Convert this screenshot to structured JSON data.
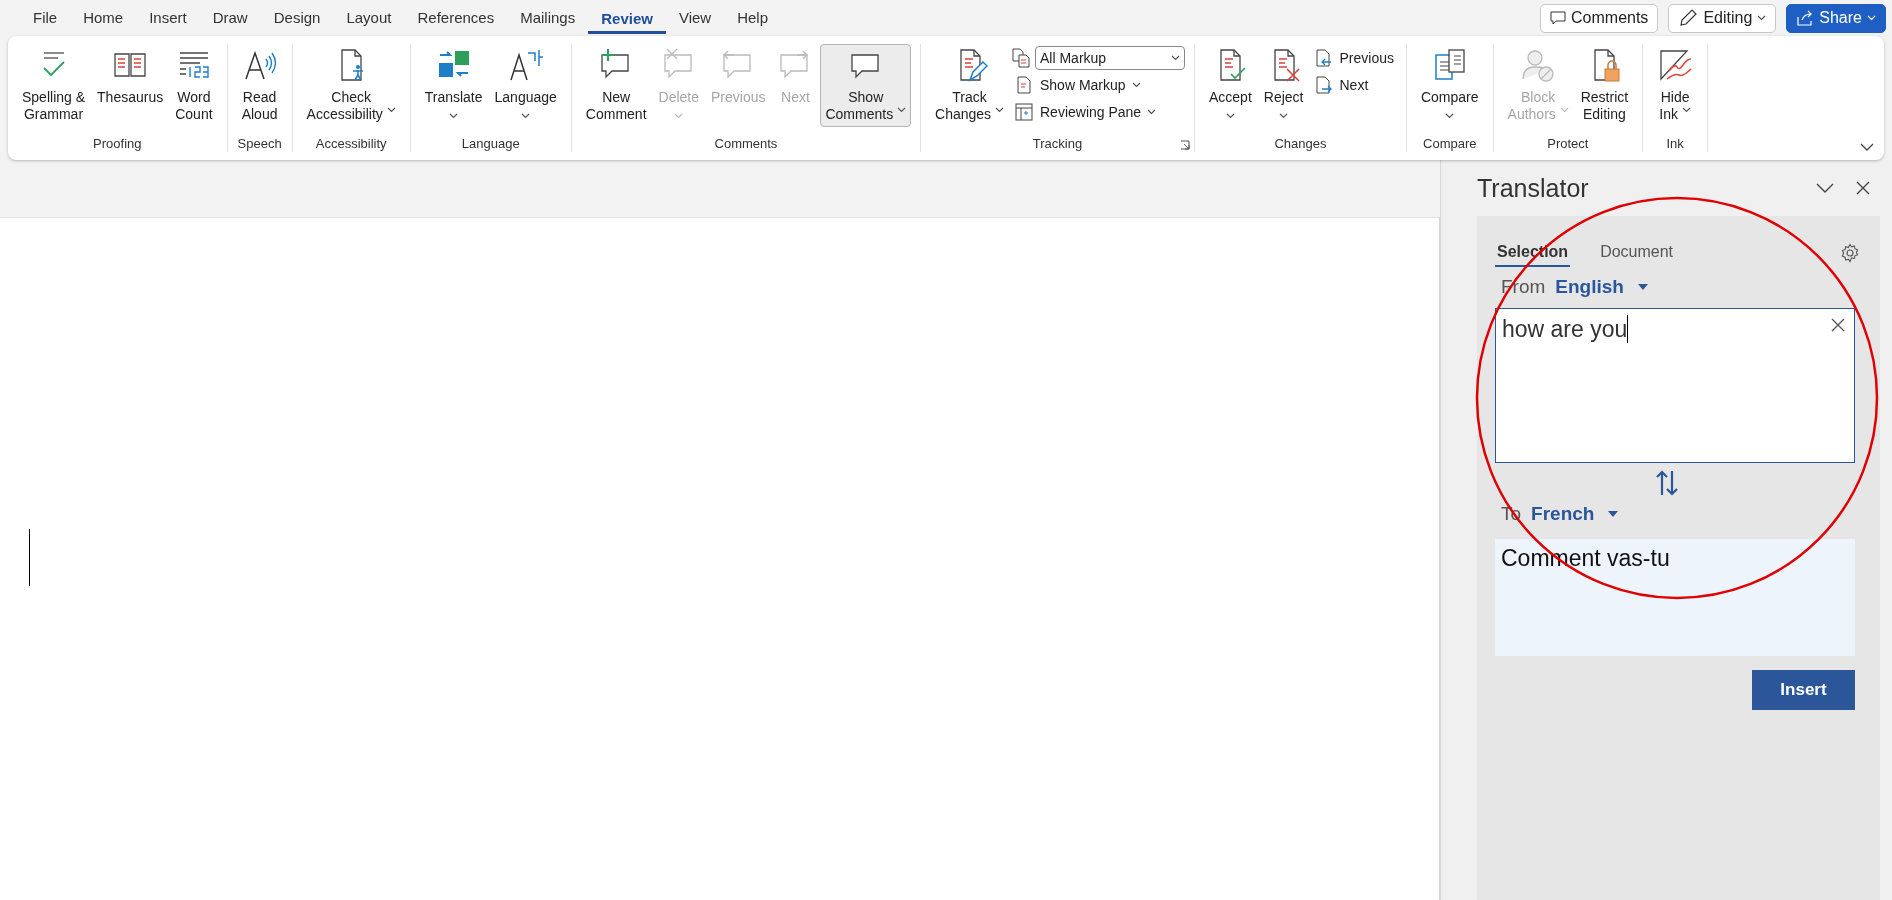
{
  "menu_tabs": [
    {
      "label": "File",
      "selected": false
    },
    {
      "label": "Home",
      "selected": false
    },
    {
      "label": "Insert",
      "selected": false
    },
    {
      "label": "Draw",
      "selected": false
    },
    {
      "label": "Design",
      "selected": false
    },
    {
      "label": "Layout",
      "selected": false
    },
    {
      "label": "References",
      "selected": false
    },
    {
      "label": "Mailings",
      "selected": false
    },
    {
      "label": "Review",
      "selected": true
    },
    {
      "label": "View",
      "selected": false
    },
    {
      "label": "Help",
      "selected": false
    }
  ],
  "header_buttons": [
    {
      "kind": "comments",
      "label": "Comments"
    },
    {
      "kind": "mode",
      "label": "Editing"
    },
    {
      "kind": "share",
      "label": "Share"
    }
  ],
  "ribbon": {
    "groups": [
      {
        "label": "Proofing",
        "items": [
          {
            "kind": "large",
            "label": "Spelling &\nGrammar",
            "disabled": false,
            "pressed": false,
            "caret": false
          },
          {
            "kind": "large",
            "label": "Thesaurus",
            "disabled": false,
            "pressed": false,
            "caret": false
          },
          {
            "kind": "large",
            "label": "Word\nCount",
            "disabled": false,
            "pressed": false,
            "caret": false
          }
        ]
      },
      {
        "label": "Speech",
        "items": [
          {
            "kind": "large",
            "label": "Read\nAloud",
            "disabled": false,
            "pressed": false,
            "caret": false
          }
        ]
      },
      {
        "label": "Accessibility",
        "items": [
          {
            "kind": "large",
            "label": "Check\nAccessibility",
            "disabled": false,
            "pressed": false,
            "caret": true,
            "caret_own_line": false
          }
        ]
      },
      {
        "label": "Language",
        "items": [
          {
            "kind": "large",
            "label": "Translate",
            "disabled": false,
            "pressed": false,
            "caret": true,
            "caret_own_line": true
          },
          {
            "kind": "large",
            "label": "Language",
            "disabled": false,
            "pressed": false,
            "caret": true,
            "caret_own_line": true
          }
        ]
      },
      {
        "label": "Comments",
        "items": [
          {
            "kind": "large",
            "label": "New\nComment",
            "disabled": false,
            "pressed": false,
            "caret": false
          },
          {
            "kind": "large",
            "label": "Delete",
            "disabled": true,
            "pressed": false,
            "caret": true,
            "caret_own_line": true
          },
          {
            "kind": "large",
            "label": "Previous",
            "disabled": true,
            "pressed": false,
            "caret": false
          },
          {
            "kind": "large",
            "label": "Next",
            "disabled": true,
            "pressed": false,
            "caret": false
          },
          {
            "kind": "large",
            "label": "Show\nComments",
            "disabled": false,
            "pressed": true,
            "caret": true,
            "caret_own_line": false
          }
        ]
      },
      {
        "label": "Tracking",
        "launcher": true,
        "items": [
          {
            "kind": "large",
            "label": "Track\nChanges",
            "disabled": false,
            "pressed": false,
            "caret": true,
            "caret_own_line": false
          },
          {
            "kind": "stack",
            "items": [
              {
                "kind": "select",
                "value": "All Markup"
              },
              {
                "kind": "small",
                "label": "Show Markup",
                "caret": true
              },
              {
                "kind": "small",
                "label": "Reviewing Pane",
                "caret": true
              }
            ]
          }
        ]
      },
      {
        "label": "Changes",
        "items": [
          {
            "kind": "large",
            "label": "Accept",
            "disabled": false,
            "pressed": false,
            "caret": true,
            "caret_own_line": true
          },
          {
            "kind": "large",
            "label": "Reject",
            "disabled": false,
            "pressed": false,
            "caret": true,
            "caret_own_line": true
          },
          {
            "kind": "stack",
            "items": [
              {
                "kind": "small",
                "label": "Previous",
                "caret": false
              },
              {
                "kind": "small",
                "label": "Next",
                "caret": false
              }
            ]
          }
        ]
      },
      {
        "label": "Compare",
        "items": [
          {
            "kind": "large",
            "label": "Compare",
            "disabled": false,
            "pressed": false,
            "caret": true,
            "caret_own_line": true
          }
        ]
      },
      {
        "label": "Protect",
        "items": [
          {
            "kind": "large",
            "label": "Block\nAuthors",
            "disabled": true,
            "pressed": false,
            "caret": true,
            "caret_own_line": false
          },
          {
            "kind": "large",
            "label": "Restrict\nEditing",
            "disabled": false,
            "pressed": false,
            "caret": false
          }
        ]
      },
      {
        "label": "Ink",
        "items": [
          {
            "kind": "large",
            "label": "Hide\nInk",
            "disabled": false,
            "pressed": false,
            "caret": true,
            "caret_own_line": false
          }
        ]
      }
    ]
  },
  "translator": {
    "title": "Translator",
    "tabs": [
      {
        "label": "Selection",
        "selected": true
      },
      {
        "label": "Document",
        "selected": false
      }
    ],
    "from_label": "From",
    "from_language": "English",
    "source_text": "how are you",
    "to_label": "To",
    "to_language": "French",
    "translation": "Comment vas-tu",
    "insert_button": "Insert"
  }
}
